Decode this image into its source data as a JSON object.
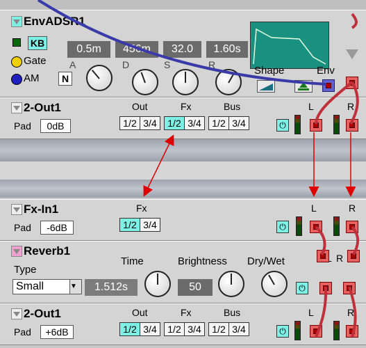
{
  "env": {
    "title": "EnvADSR1",
    "kb": "KB",
    "gate": "Gate",
    "am": "AM",
    "n": "N",
    "a": "A",
    "d": "D",
    "s": "S",
    "r": "R",
    "v1": "0.5m",
    "v2": "456m",
    "v3": "32.0",
    "v4": "1.60s",
    "shape": "Shape",
    "env": "Env"
  },
  "out1": {
    "title": "2-Out1",
    "pad": "Pad",
    "pad_val": "0dB",
    "out": "Out",
    "fx": "Fx",
    "bus": "Bus",
    "segs": [
      "1/2",
      "3/4",
      "1/2",
      "3/4",
      "1/2",
      "3/4"
    ],
    "l": "L",
    "r": "R"
  },
  "fxin": {
    "title": "Fx-In1",
    "pad": "Pad",
    "pad_val": "-6dB",
    "fx": "Fx",
    "segs": [
      "1/2",
      "3/4"
    ],
    "l": "L",
    "r": "R"
  },
  "reverb": {
    "title": "Reverb1",
    "type": "Type",
    "type_val": "Small",
    "time": "Time",
    "time_val": "1.512s",
    "brightness": "Brightness",
    "bright_val": "50",
    "drywet": "Dry/Wet",
    "l": "L",
    "r": "R"
  },
  "out2": {
    "title": "2-Out1",
    "pad": "Pad",
    "pad_val": "+6dB",
    "out": "Out",
    "fx": "Fx",
    "bus": "Bus",
    "segs": [
      "1/2",
      "3/4",
      "1/2",
      "3/4",
      "1/2",
      "3/4"
    ],
    "l": "L",
    "r": "R"
  },
  "colors": {
    "cyan": "#7ef0e6",
    "jack": "#e86060",
    "cable": "#c0303a",
    "blue_cable": "#3a3aa8",
    "arrow": "#e00000"
  }
}
